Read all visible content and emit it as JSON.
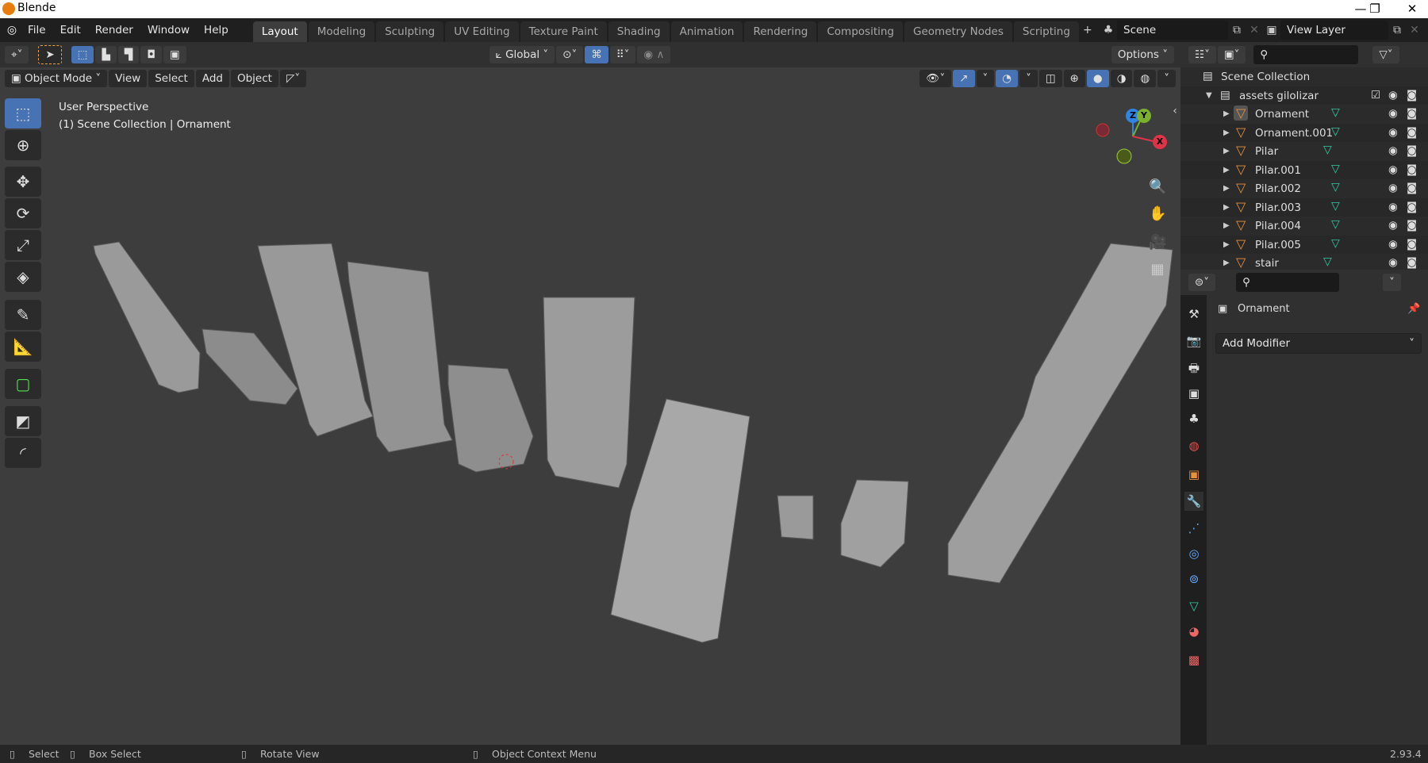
{
  "window": {
    "title": "Blende",
    "min": "—",
    "max": "❐",
    "close": "✕"
  },
  "menu": [
    "File",
    "Edit",
    "Render",
    "Window",
    "Help"
  ],
  "workspaces": [
    "Layout",
    "Modeling",
    "Sculpting",
    "UV Editing",
    "Texture Paint",
    "Shading",
    "Animation",
    "Rendering",
    "Compositing",
    "Geometry Nodes",
    "Scripting"
  ],
  "active_workspace": "Layout",
  "scene": {
    "name": "Scene",
    "view_layer": "View Layer"
  },
  "toolheader": {
    "orientation": "Global",
    "options": "Options"
  },
  "viewport_header": {
    "mode": "Object Mode",
    "menus": [
      "View",
      "Select",
      "Add",
      "Object"
    ]
  },
  "viewport": {
    "perspective": "User Perspective",
    "context": "(1) Scene Collection | Ornament",
    "gizmo": {
      "z": "Z",
      "y": "Y",
      "x": "X"
    }
  },
  "outliner": {
    "root": "Scene Collection",
    "collection": "assets gilolizar",
    "items": [
      "Ornament",
      "Ornament.001",
      "Pilar",
      "Pilar.001",
      "Pilar.002",
      "Pilar.003",
      "Pilar.004",
      "Pilar.005",
      "stair"
    ],
    "selected": "Ornament"
  },
  "properties": {
    "object": "Ornament",
    "add_modifier": "Add Modifier",
    "active_tab": "modifiers"
  },
  "status": {
    "select": "Select",
    "box_select": "Box Select",
    "rotate": "Rotate View",
    "context_menu": "Object Context Menu",
    "version": "2.93.4"
  },
  "colors": {
    "accent": "#4772b3",
    "object": "#e8913c",
    "mesh": "#2bcba3",
    "axis_x": "#e0334a",
    "axis_y": "#7ab02c",
    "axis_z": "#2f85e3"
  }
}
